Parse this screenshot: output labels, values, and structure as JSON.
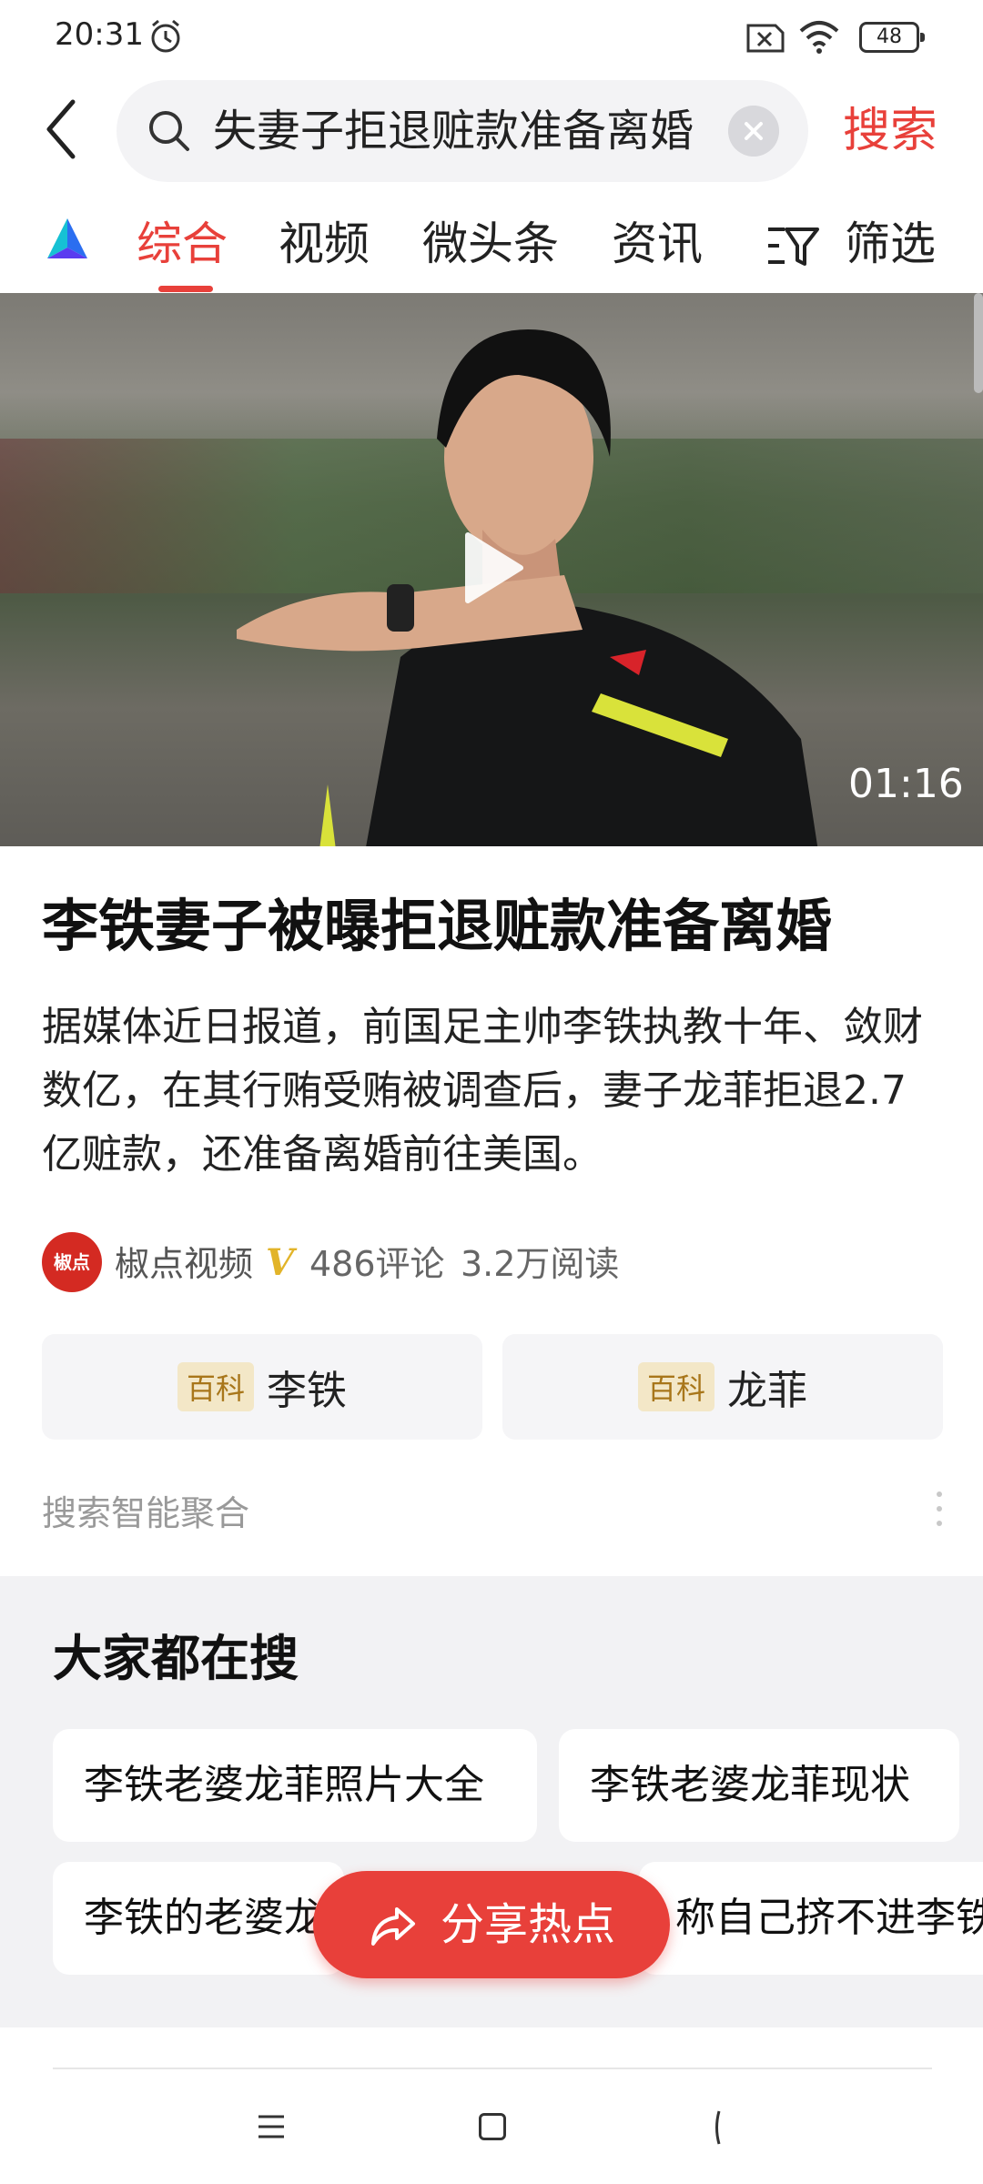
{
  "status_bar": {
    "time": "20:31",
    "battery": "48"
  },
  "search": {
    "query": "失妻子拒退赃款准备离婚",
    "button_label": "搜索"
  },
  "tabs": [
    {
      "label": "综合",
      "active": true
    },
    {
      "label": "视频"
    },
    {
      "label": "微头条"
    },
    {
      "label": "资讯"
    }
  ],
  "filter_label": "筛选",
  "video": {
    "duration": "01:16"
  },
  "article": {
    "title": "李铁妻子被曝拒退赃款准备离婚",
    "summary": "据媒体近日报道，前国足主帅李铁执教十年、敛财数亿，在其行贿受贿被调查后，妻子龙菲拒退2.7亿赃款，还准备离婚前往美国。",
    "source_logo_text": "椒点",
    "source": "椒点视频",
    "verified_badge": "V",
    "comments": "486评论",
    "reads": "3.2万阅读"
  },
  "baike": [
    {
      "tag": "百科",
      "name": "李铁"
    },
    {
      "tag": "百科",
      "name": "龙菲"
    }
  ],
  "aggregate_label": "搜索智能聚合",
  "hot_searches": {
    "title": "大家都在搜",
    "items": [
      "李铁老婆龙菲照片大全",
      "李铁老婆龙菲现状",
      "李铁的老婆龙",
      "称自己挤不进李铁"
    ]
  },
  "share_button": "分享热点",
  "colors": {
    "accent": "#e8403a",
    "baike_tag_bg": "#f3e7c7",
    "baike_tag_text": "#a8761a"
  }
}
